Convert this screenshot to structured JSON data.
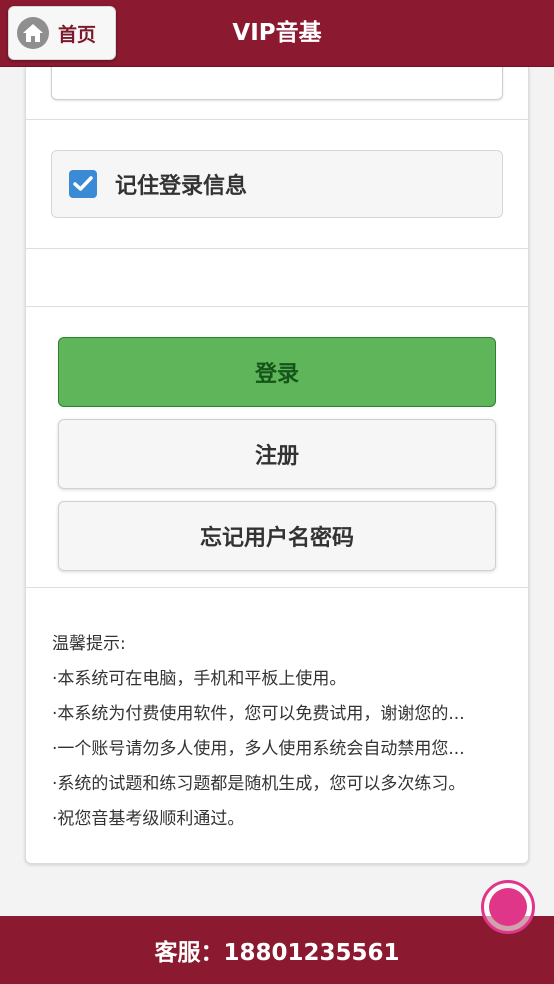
{
  "header": {
    "home_label": "首页",
    "title": "VIP音基"
  },
  "login": {
    "remember_label": "记住登录信息",
    "remember_checked": true,
    "login_button": "登录",
    "register_button": "注册",
    "forgot_button": "忘记用户名密码"
  },
  "tips": {
    "heading": "温馨提示:",
    "items": [
      "·本系统可在电脑，手机和平板上使用。",
      "·本系统为付费使用软件，您可以免费试用，谢谢您的...",
      "·一个账号请勿多人使用，多人使用系统会自动禁用您...",
      "·系统的试题和练习题都是随机生成，您可以多次练习。",
      "·祝您音基考级顺利通过。"
    ]
  },
  "footer": {
    "service_text": "客服：18801235561"
  },
  "colors": {
    "brand": "#8b1a30",
    "login_green": "#5fb55a",
    "checkbox_blue": "#3a8ad6",
    "float_pink": "#e0368a"
  },
  "icons": {
    "home": "house-icon",
    "check": "check-icon",
    "float": "assistive-touch-icon"
  }
}
